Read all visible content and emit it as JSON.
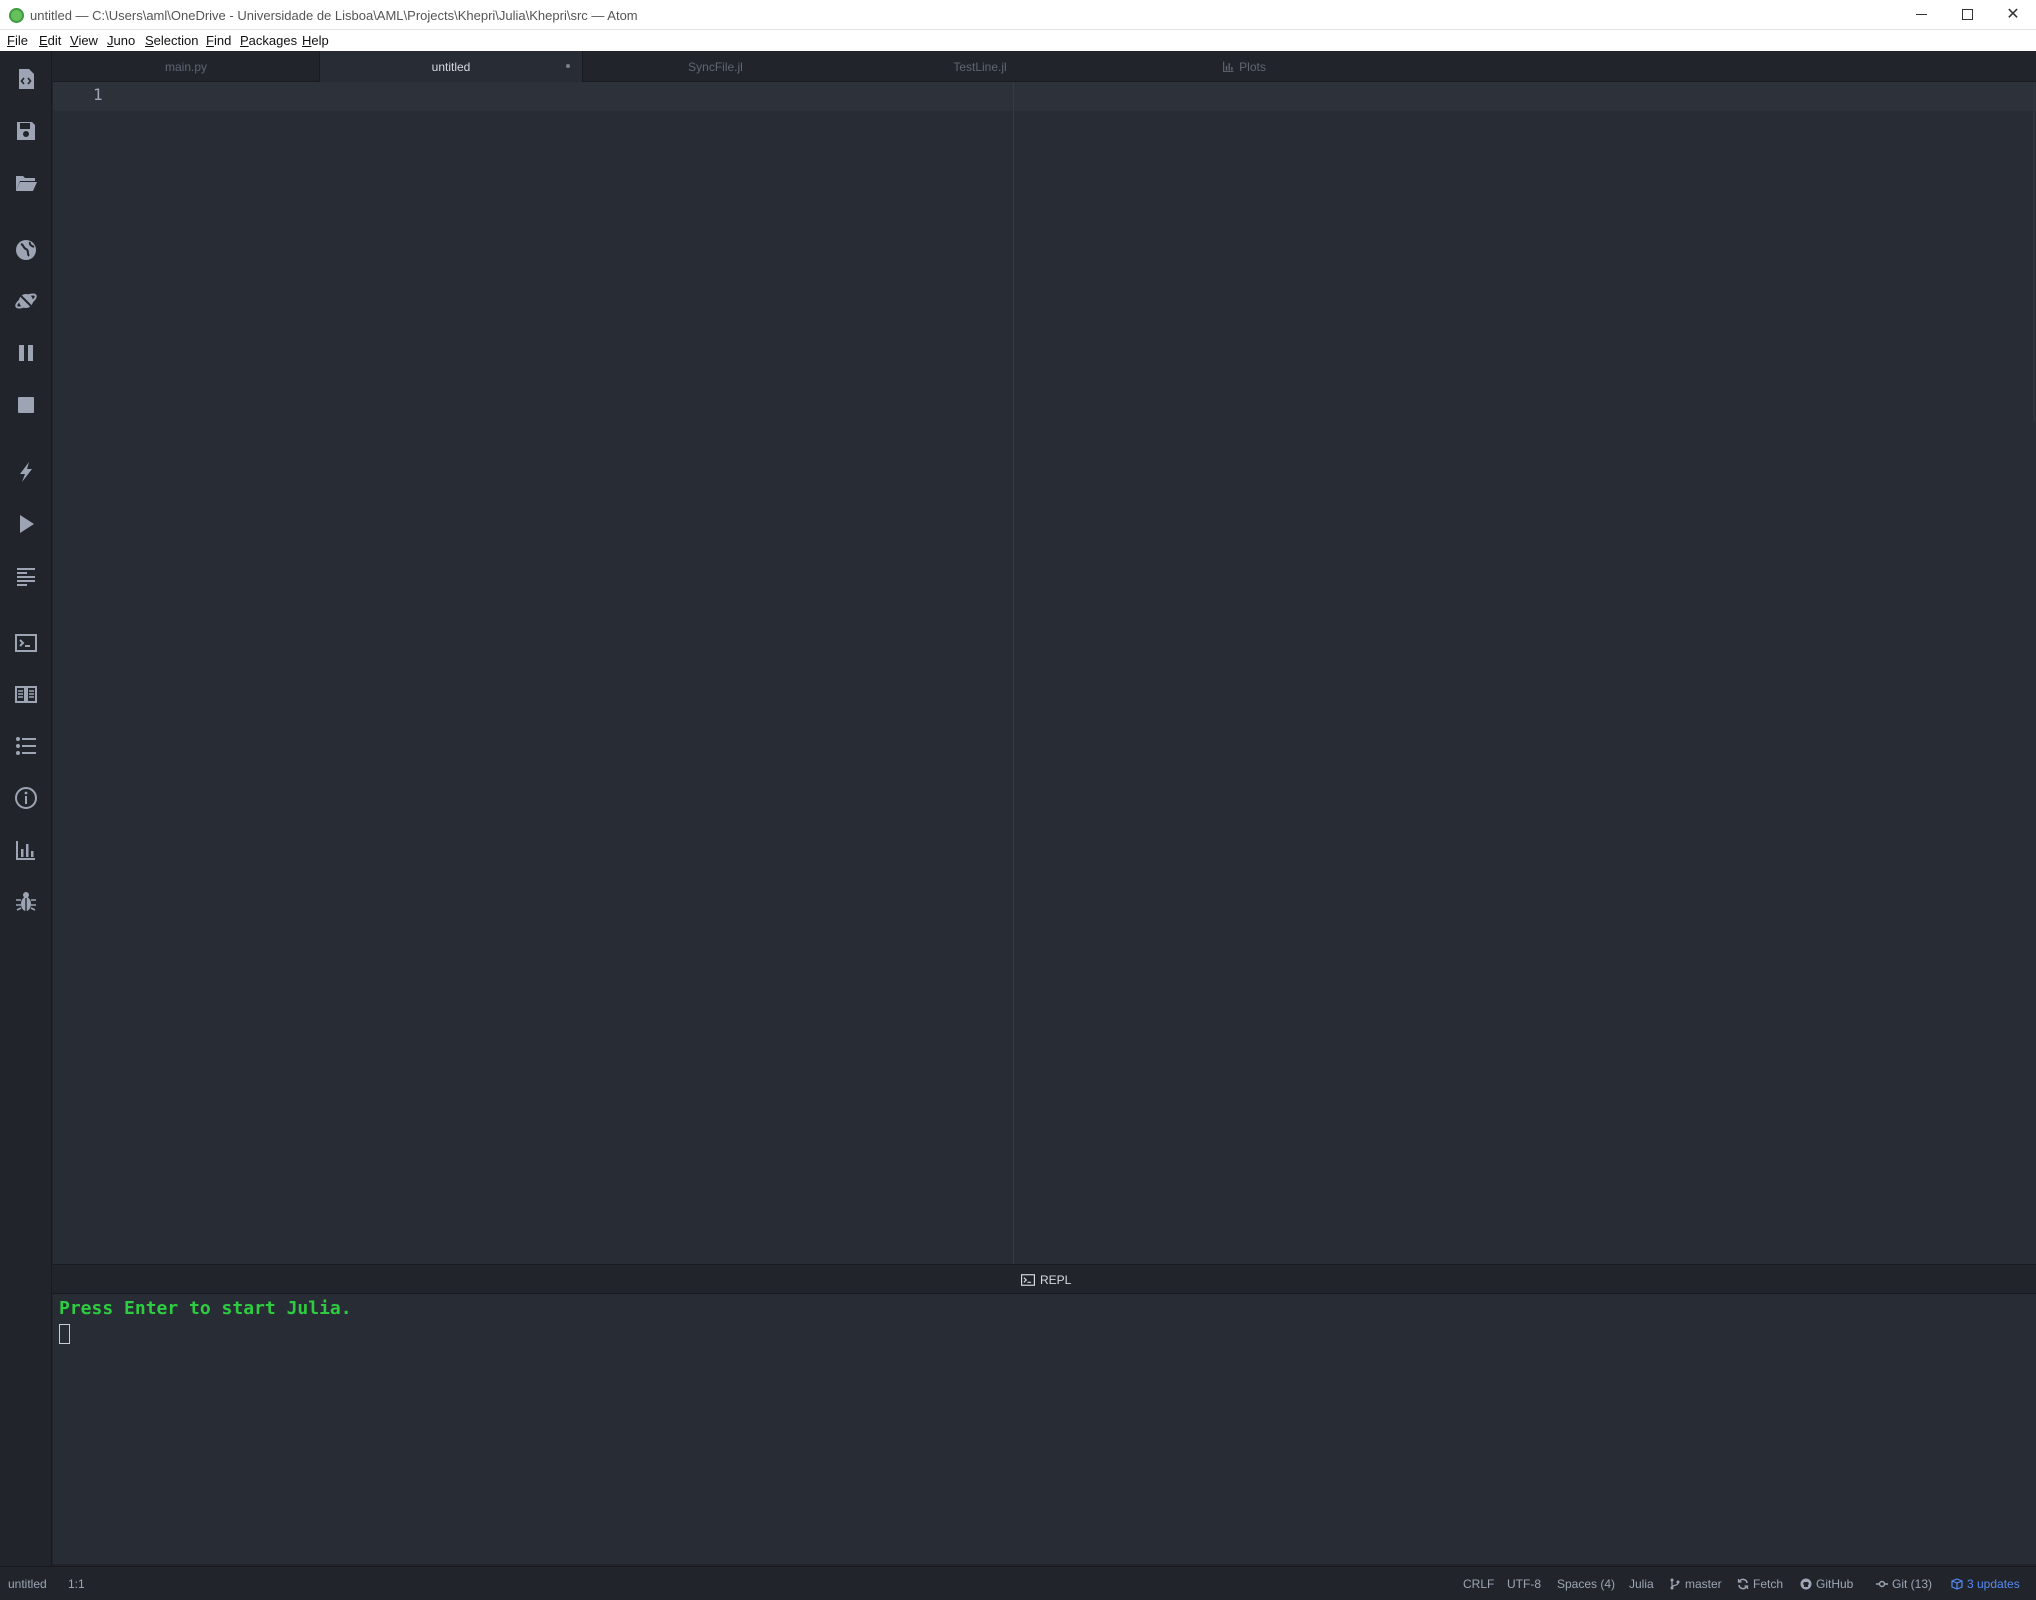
{
  "window": {
    "title": "untitled — C:\\Users\\aml\\OneDrive - Universidade de Lisboa\\AML\\Projects\\Khepri\\Julia\\Khepri\\src — Atom"
  },
  "menu": [
    {
      "label": "File",
      "mnemonic": "F",
      "rest": "ile"
    },
    {
      "label": "Edit",
      "mnemonic": "E",
      "rest": "dit"
    },
    {
      "label": "View",
      "mnemonic": "V",
      "rest": "iew"
    },
    {
      "label": "Juno",
      "mnemonic": "J",
      "rest": "uno"
    },
    {
      "label": "Selection",
      "mnemonic": "S",
      "rest": "election"
    },
    {
      "label": "Find",
      "mnemonic": "F",
      "rest": "ind"
    },
    {
      "label": "Packages",
      "mnemonic": "P",
      "rest": "ackages"
    },
    {
      "label": "Help",
      "mnemonic": "H",
      "rest": "elp"
    }
  ],
  "tabs": [
    {
      "label": "main.py",
      "active": false
    },
    {
      "label": "untitled",
      "active": true,
      "modified": true
    },
    {
      "label": "SyncFile.jl",
      "active": false
    },
    {
      "label": "TestLine.jl",
      "active": false
    },
    {
      "label": "Plots",
      "active": false,
      "icon": "bar-chart-icon"
    }
  ],
  "toolbar_icons": [
    "new-file-icon",
    "save-icon",
    "open-folder-icon",
    "globe-icon",
    "disconnect-icon",
    "pause-icon",
    "stop-icon",
    "lightning-icon",
    "run-icon",
    "format-icon",
    "terminal-icon",
    "book-icon",
    "list-icon",
    "info-icon",
    "bar-chart-icon",
    "bug-icon"
  ],
  "editor": {
    "line_numbers": [
      "1"
    ]
  },
  "repl": {
    "tab_label": "REPL",
    "message": "Press Enter to start Julia."
  },
  "statusbar": {
    "file": "untitled",
    "cursor": "1:1",
    "line_ending": "CRLF",
    "encoding": "UTF-8",
    "indent": "Spaces (4)",
    "grammar": "Julia",
    "branch": "master",
    "fetch": "Fetch",
    "github": "GitHub",
    "git": "Git (13)",
    "updates": "3 updates"
  },
  "colors": {
    "editor_bg": "#282c34",
    "panel_bg": "#21252b",
    "repl_message": "#2ecc40",
    "updates": "#568af2"
  }
}
